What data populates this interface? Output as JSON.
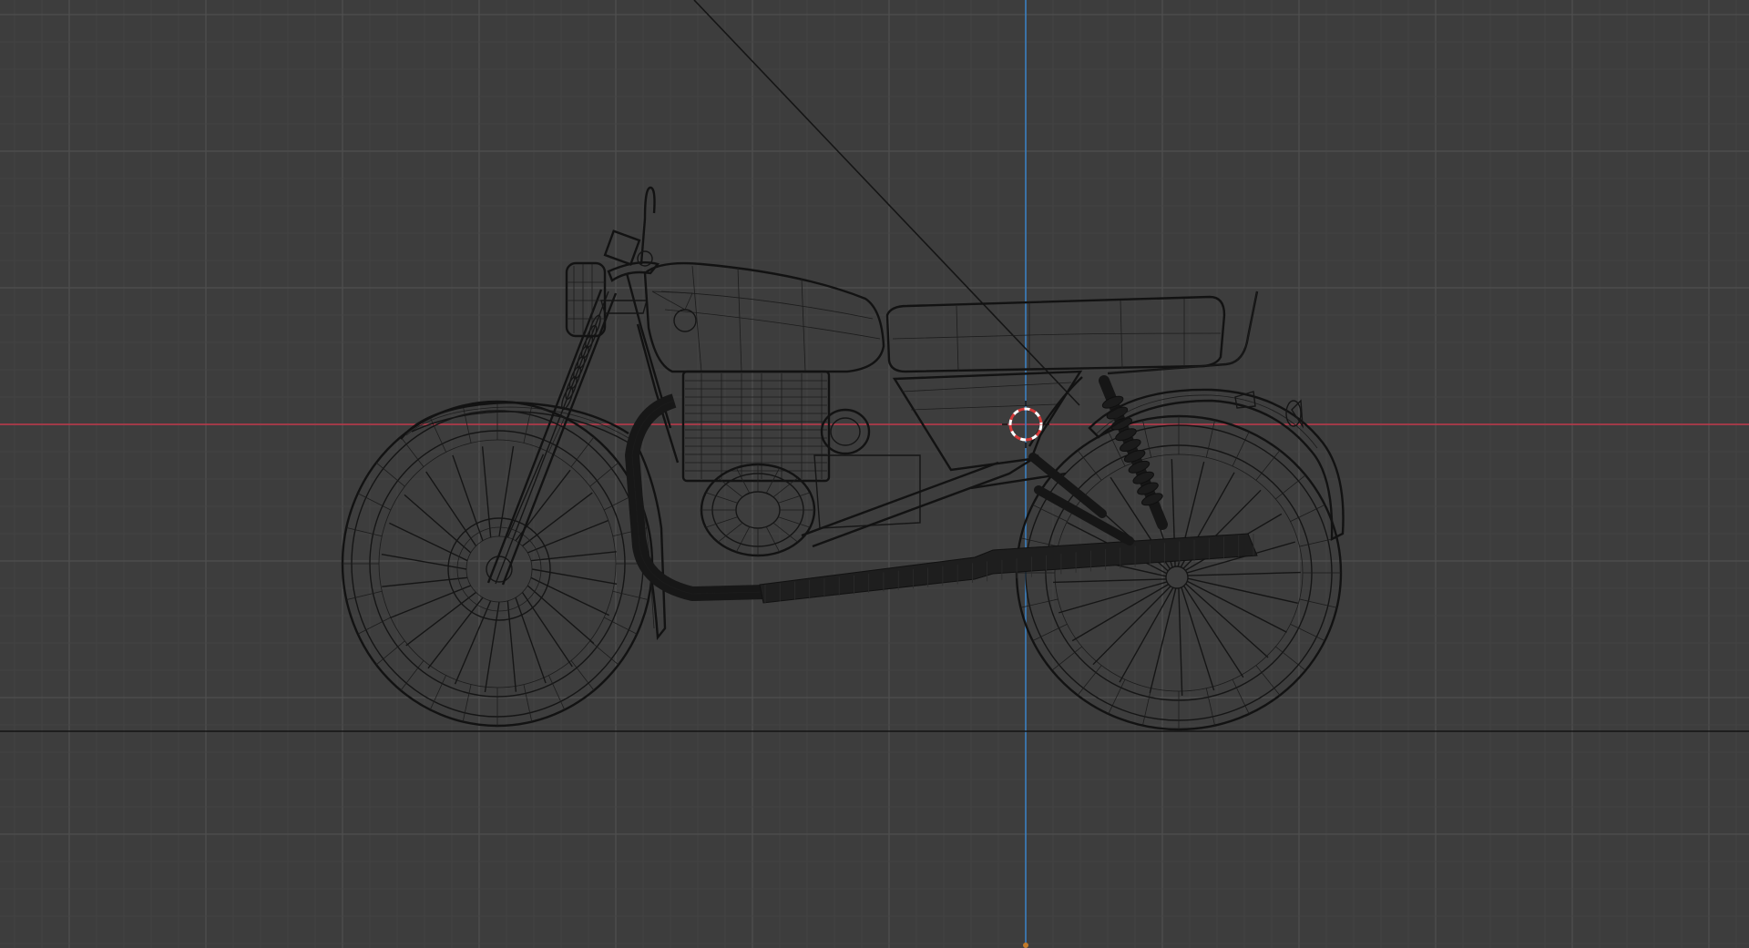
{
  "viewport": {
    "view": "wireframe-side-view",
    "background_color": "#3d3d3d",
    "grid": true,
    "minor_grid_color": "#444444",
    "major_grid_color": "#4f4f4f",
    "x_axis_color": "#c0384a",
    "z_axis_color": "#3a7fc0",
    "wire_color": "#141414"
  },
  "scene_objects": [
    {
      "name": "motorcycle",
      "shading": "wireframe"
    },
    {
      "name": "ground-line"
    },
    {
      "name": "camera-line"
    },
    {
      "name": "3d-cursor"
    }
  ]
}
